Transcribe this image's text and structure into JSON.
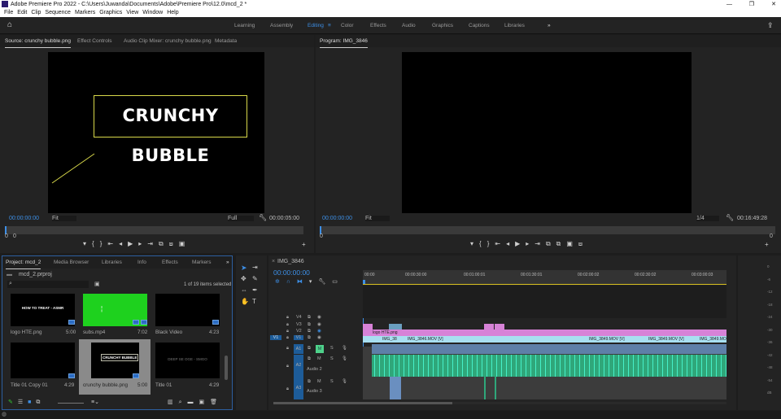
{
  "window": {
    "title": "Adobe Premiere Pro 2022 - C:\\Users\\Juwanda\\Documents\\Adobe\\Premiere Pro\\12.0\\mcd_2 *"
  },
  "menu": [
    "File",
    "Edit",
    "Clip",
    "Sequence",
    "Markers",
    "Graphics",
    "View",
    "Window",
    "Help"
  ],
  "workspaces": [
    "Learning",
    "Assembly",
    "Editing",
    "Color",
    "Effects",
    "Audio",
    "Graphics",
    "Captions",
    "Libraries"
  ],
  "source": {
    "tabs": [
      "Source: crunchy bubble.png",
      "Effect Controls",
      "Audio Clip Mixer: crunchy bubble.png",
      "Metadata"
    ],
    "overlay_text": "CRUNCHY BUBBLE",
    "timecode": "00:00:00:00",
    "fit": "Fit",
    "quality": "Full",
    "duration": "00:00:05:00",
    "in": "0",
    "out": "0"
  },
  "program": {
    "tab": "Program: IMG_3846",
    "timecode": "00:00:00:00",
    "fit": "Fit",
    "quality": "1/4",
    "duration": "00:16:49:28",
    "in": "0",
    "out": "0"
  },
  "project": {
    "tabs": [
      "Project: mcd_2",
      "Media Browser",
      "Libraries",
      "Info",
      "Effects",
      "Markers"
    ],
    "file": "mcd_2.prproj",
    "search_placeholder": "",
    "selection": "1 of 19 items selected",
    "items": [
      {
        "name": "logo HTE.png",
        "dur": "5:00",
        "thumb": "HOW TO TREAT - ASMR"
      },
      {
        "name": "subs.mp4",
        "dur": "7:02"
      },
      {
        "name": "Black Video",
        "dur": "4:23"
      },
      {
        "name": "Title 01 Copy 01",
        "dur": "4:29"
      },
      {
        "name": "crunchy bubble.png",
        "dur": "5:00",
        "thumb": "CRUNCHY BUBBLE"
      },
      {
        "name": "Title 01",
        "dur": "4:29",
        "thumb": "DEEP SE OGE - SMGO"
      }
    ]
  },
  "timeline": {
    "tab": "IMG_3846",
    "timecode": "00:00:00:00",
    "ruler": [
      "00:00",
      "00:00:30:00",
      "00:01:00:01",
      "00:01:30:01",
      "00:02:00:02",
      "00:02:30:02",
      "00:03:00:03"
    ],
    "tracks": {
      "v4": "V4",
      "v3": "V3",
      "v2": "V2",
      "v1": "V1",
      "src_v1": "V1",
      "a1": "A1",
      "a2": "A2",
      "a3": "A3",
      "audio2": "Audio 2",
      "audio3": "Audio 3",
      "m": "M",
      "s": "S"
    },
    "clips": {
      "logo": "logo HTE.png",
      "c1": "IMG_38",
      "c2": "IMG_3846.MOV [V]",
      "c3": "IMG_3849.MOV [V]",
      "c4": "IMG_3849.MOV [V]",
      "c5": "IMG_3849.MO"
    }
  },
  "meter": [
    "0",
    "-6",
    "-12",
    "-18",
    "-24",
    "-30",
    "-36",
    "-42",
    "-48",
    "-54",
    "dB"
  ]
}
